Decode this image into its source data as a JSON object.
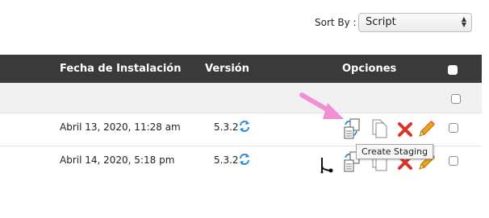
{
  "sort": {
    "label": "Sort By :",
    "selected": "Script"
  },
  "table": {
    "headers": {
      "fecha": "Fecha de Instalación",
      "version": "Versión",
      "opciones": "Opciones"
    },
    "rows": [
      {
        "date": "Abril 13, 2020, 11:28 am",
        "version": "5.3.2"
      },
      {
        "date": "Abril 14, 2020, 5:18 pm",
        "version": "5.3.2"
      }
    ]
  },
  "tooltip": "Create Staging",
  "colors": {
    "header_bg": "#3a3a3a",
    "annotation_arrow": "#f08fd6",
    "delete": "#d9342b",
    "refresh": "#2a8fd8"
  },
  "icons": [
    "staging-icon",
    "clone-icon",
    "delete-icon",
    "edit-icon",
    "git-branch-icon",
    "refresh-icon"
  ]
}
